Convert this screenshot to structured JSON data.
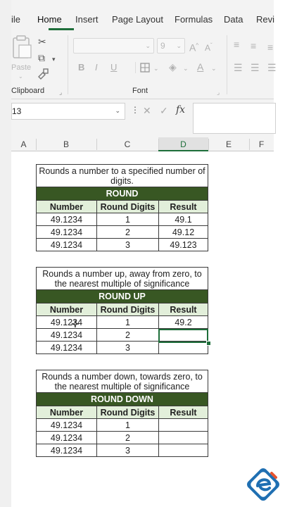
{
  "ribbon": {
    "tabs": [
      {
        "label": "ile",
        "active": false
      },
      {
        "label": "Home",
        "active": true
      },
      {
        "label": "Insert",
        "active": false
      },
      {
        "label": "Page Layout",
        "active": false
      },
      {
        "label": "Formulas",
        "active": false
      },
      {
        "label": "Data",
        "active": false
      },
      {
        "label": "Revi",
        "active": false
      }
    ],
    "clipboard_label": "Clipboard",
    "paste_label": "Paste",
    "font_label": "Font",
    "font_size": "9",
    "bold": "B",
    "italic": "I",
    "underline": "U",
    "font_color": "A"
  },
  "formula_bar": {
    "name_box": "13",
    "fx_label": "fx",
    "cancel": "✕",
    "confirm": "✓"
  },
  "columns": [
    "A",
    "B",
    "C",
    "D",
    "E",
    "F"
  ],
  "selected_column": "D",
  "tables": [
    {
      "description": "Rounds a number to a specified number of digits.",
      "title": "ROUND",
      "headers": [
        "Number",
        "Round Digits",
        "Result"
      ],
      "rows": [
        [
          "49.1234",
          "1",
          "49.1"
        ],
        [
          "49.1234",
          "2",
          "49.12"
        ],
        [
          "49.1234",
          "3",
          "49.123"
        ]
      ]
    },
    {
      "description": "Rounds a number up, away from zero, to the nearest multiple of significance",
      "title": "ROUND UP",
      "headers": [
        "Number",
        "Round Digits",
        "Result"
      ],
      "rows": [
        [
          "49.1234",
          "1",
          "49.2"
        ],
        [
          "49.1234",
          "2",
          ""
        ],
        [
          "49.1234",
          "3",
          ""
        ]
      ]
    },
    {
      "description": "Rounds a number down, towards zero, to the nearest multiple of significance",
      "title": "ROUND DOWN",
      "headers": [
        "Number",
        "Round Digits",
        "Result"
      ],
      "rows": [
        [
          "49.1234",
          "1",
          ""
        ],
        [
          "49.1234",
          "2",
          ""
        ],
        [
          "49.1234",
          "3",
          ""
        ]
      ]
    }
  ],
  "colors": {
    "accent": "#1e6e3a",
    "title_fill": "#385723",
    "header_fill": "#e2efda",
    "logo": "#1f6fb2"
  }
}
